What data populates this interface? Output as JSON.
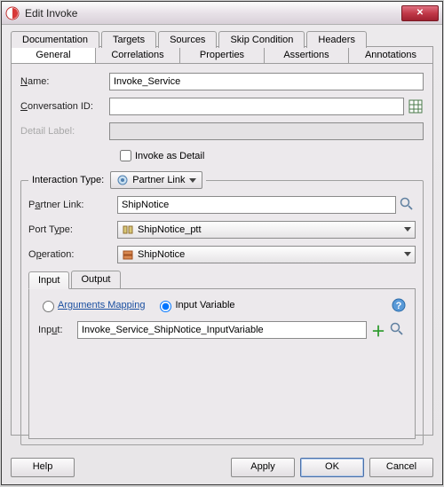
{
  "window": {
    "title": "Edit Invoke"
  },
  "tabs_row1": [
    "Documentation",
    "Targets",
    "Sources",
    "Skip Condition",
    "Headers"
  ],
  "tabs_row2": [
    "General",
    "Correlations",
    "Properties",
    "Assertions",
    "Annotations"
  ],
  "active_tab": "General",
  "fields": {
    "name_label": "Name:",
    "name_value": "Invoke_Service",
    "conversation_label": "Conversation ID:",
    "conversation_value": "",
    "detail_label": "Detail Label:",
    "detail_value": "",
    "invoke_as_detail": "Invoke as Detail",
    "invoke_as_detail_checked": false
  },
  "interaction": {
    "legend": "Interaction Type:",
    "partner_link_btn": "Partner Link",
    "partner_link_label": "Partner Link:",
    "partner_link_value": "ShipNotice",
    "port_type_label": "Port Type:",
    "port_type_value": "ShipNotice_ptt",
    "operation_label": "Operation:",
    "operation_value": "ShipNotice"
  },
  "io_tabs": {
    "input": "Input",
    "output": "Output",
    "active": "Input"
  },
  "io": {
    "args_mapping": "Arguments Mapping",
    "input_variable": "Input Variable",
    "selected": "input_variable",
    "input_label": "Input:",
    "input_value": "Invoke_Service_ShipNotice_InputVariable"
  },
  "buttons": {
    "help": "Help",
    "apply": "Apply",
    "ok": "OK",
    "cancel": "Cancel"
  }
}
